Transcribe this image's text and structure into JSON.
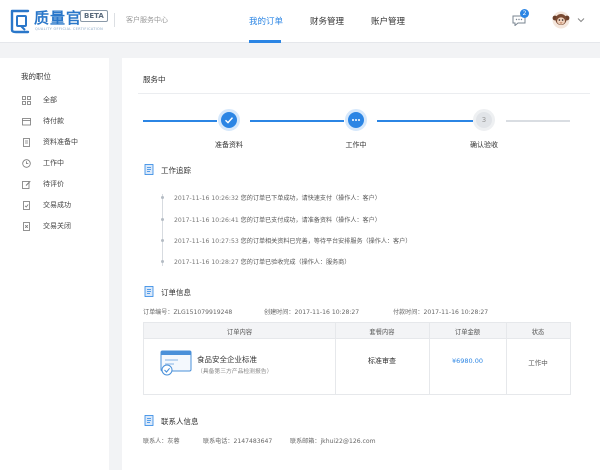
{
  "header": {
    "brand": "质量官",
    "brand_sub": "QUALITY OFFICIAL CERTIFICATION",
    "beta": "BETA",
    "subtitle": "客户服务中心",
    "nav": [
      "我的订单",
      "财务管理",
      "账户管理"
    ],
    "message_count": "2",
    "accent": "#2b85e4"
  },
  "sidebar": {
    "title": "我的职位",
    "items": [
      {
        "label": "全部",
        "icon": "grid-icon"
      },
      {
        "label": "待付款",
        "icon": "wallet-icon"
      },
      {
        "label": "资料准备中",
        "icon": "document-icon"
      },
      {
        "label": "工作中",
        "icon": "clock-icon"
      },
      {
        "label": "待评价",
        "icon": "edit-icon"
      },
      {
        "label": "交易成功",
        "icon": "check-document-icon"
      },
      {
        "label": "交易关闭",
        "icon": "closed-document-icon"
      }
    ]
  },
  "main": {
    "status_title": "服务中",
    "steps": [
      {
        "label": "准备资料",
        "state": "done"
      },
      {
        "label": "工作中",
        "state": "current"
      },
      {
        "label": "确认验收",
        "state": "pending",
        "number": "3"
      }
    ],
    "tracking": {
      "title": "工作追踪",
      "entries": [
        {
          "time": "2017-11-16 10:26:32",
          "text": "您的订单已下单成功，请快速支付（操作人：客户）"
        },
        {
          "time": "2017-11-16 10:26:41",
          "text": "您的订单已支付成功，请准备资料（操作人：客户）"
        },
        {
          "time": "2017-11-16 10:27:53",
          "text": "您的订单相关资料已完善，等待平台安排服务（操作人：客户）"
        },
        {
          "time": "2017-11-16 10:28:27",
          "text": "您的订单已验收完成（操作人：服务商）"
        }
      ]
    },
    "order": {
      "title": "订单信息",
      "order_no": "订单编号：ZLG151079919248",
      "created": "创建时间：2017-11-16 10:28:27",
      "paid": "付款时间：2017-11-16 10:28:27",
      "columns": [
        "订单内容",
        "套餐内容",
        "订单金额",
        "状态"
      ],
      "product_name": "食品安全企业标准",
      "product_desc": "（具备第三方产品检测报告）",
      "package": "标准审查",
      "amount": "¥6980.00",
      "status": "工作中"
    },
    "contact": {
      "title": "联系人信息",
      "name": "联系人：灰蓉",
      "phone": "联系电话：2147483647",
      "email": "联系邮箱：jkhui22@126.com"
    }
  }
}
